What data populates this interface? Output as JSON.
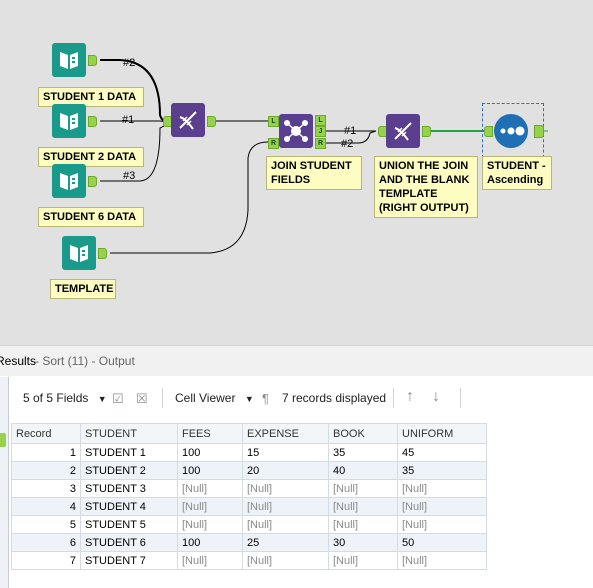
{
  "workflow": {
    "tools": {
      "student1_label": "STUDENT 1 DATA",
      "student2_label": "STUDENT 2 DATA",
      "student6_label": "STUDENT 6 DATA",
      "template_label": "TEMPLATE",
      "join_label": "JOIN STUDENT\nFIELDS",
      "union_label": "UNION THE JOIN\nAND THE BLANK\nTEMPLATE\n(RIGHT OUTPUT)",
      "sort_label": "STUDENT -\nAscending"
    },
    "wire_labels": {
      "s1": "#2",
      "s2": "#1",
      "s6": "#3",
      "j1": "#1",
      "r2": "#2"
    },
    "join_ports": {
      "left": "L",
      "right": "R",
      "out_l": "L",
      "out_j": "J",
      "out_r": "R"
    },
    "colors": {
      "input": "#1a9a8b",
      "dna": "#5b3f8f",
      "sort": "#1f6fb4",
      "anchor": "#97d24f",
      "wire_green": "#22a34a"
    }
  },
  "results": {
    "title": "Results",
    "subtitle": " - Sort (11) - Output",
    "toolbar": {
      "fields": "5 of 5 Fields",
      "cell_viewer": "Cell Viewer",
      "records": "7 records displayed"
    },
    "columns": [
      "Record",
      "STUDENT",
      "FEES",
      "EXPENSE",
      "BOOK",
      "UNIFORM"
    ],
    "rows": [
      [
        "1",
        "STUDENT 1",
        "100",
        "15",
        "35",
        "45"
      ],
      [
        "2",
        "STUDENT 2",
        "100",
        "20",
        "40",
        "35"
      ],
      [
        "3",
        "STUDENT 3",
        "[Null]",
        "[Null]",
        "[Null]",
        "[Null]"
      ],
      [
        "4",
        "STUDENT 4",
        "[Null]",
        "[Null]",
        "[Null]",
        "[Null]"
      ],
      [
        "5",
        "STUDENT 5",
        "[Null]",
        "[Null]",
        "[Null]",
        "[Null]"
      ],
      [
        "6",
        "STUDENT 6",
        "100",
        "25",
        "30",
        "50"
      ],
      [
        "7",
        "STUDENT 7",
        "[Null]",
        "[Null]",
        "[Null]",
        "[Null]"
      ]
    ]
  }
}
